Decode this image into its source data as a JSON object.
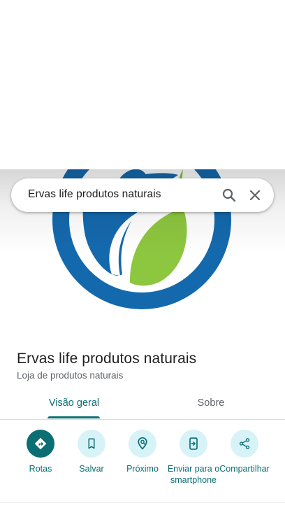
{
  "search": {
    "query": "Ervas life produtos naturais"
  },
  "place": {
    "name": "Ervas life produtos naturais",
    "category": "Loja de produtos naturais"
  },
  "tabs": [
    {
      "label": "Visão geral",
      "selected": true
    },
    {
      "label": "Sobre",
      "selected": false
    }
  ],
  "actions": [
    {
      "label": "Rotas",
      "icon": "directions-icon"
    },
    {
      "label": "Salvar",
      "icon": "bookmark-icon"
    },
    {
      "label": "Próximo",
      "icon": "nearby-icon"
    },
    {
      "label": "Enviar para o smartphone",
      "icon": "send-to-phone-icon"
    },
    {
      "label": "Compartilhar",
      "icon": "share-icon"
    }
  ],
  "colors": {
    "accent": "#0b6e73",
    "action_bg": "#d7f3f8",
    "logo_blue": "#1469ad",
    "logo_green": "#8dc63f"
  }
}
